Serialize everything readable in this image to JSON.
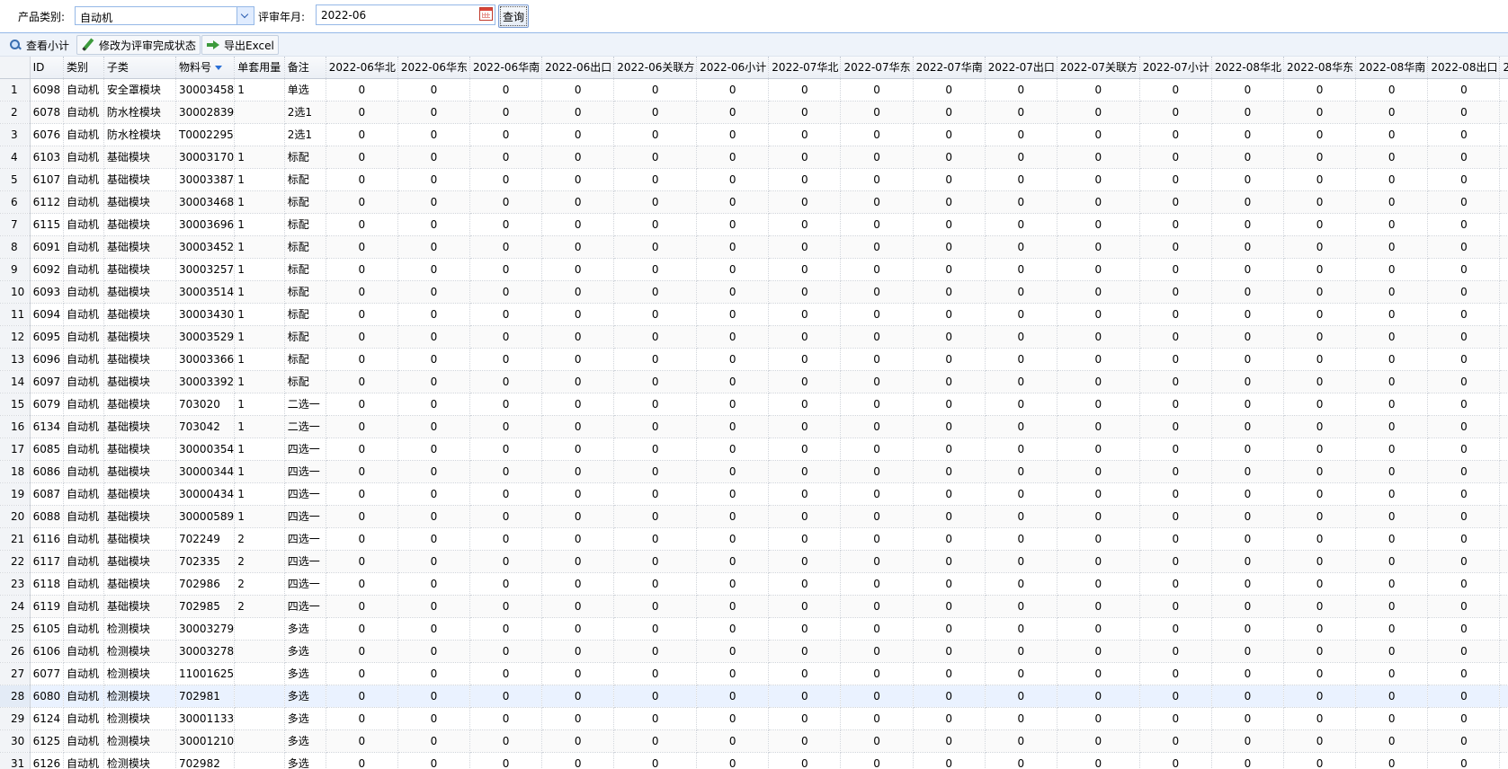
{
  "filter": {
    "category_label": "产品类别:",
    "category_value": "自动机",
    "month_label": "评审年月:",
    "month_value": "2022-06",
    "query_label": "查询"
  },
  "toolbar": {
    "view_subtotal": "查看小计",
    "mark_done": "修改为评审完成状态",
    "export_excel": "导出Excel"
  },
  "grid": {
    "columns": [
      "ID",
      "类别",
      "子类",
      "物料号",
      "单套用量",
      "备注",
      "2022-06华北",
      "2022-06华东",
      "2022-06华南",
      "2022-06出口",
      "2022-06关联方",
      "2022-06小计",
      "2022-07华北",
      "2022-07华东",
      "2022-07华南",
      "2022-07出口",
      "2022-07关联方",
      "2022-07小计",
      "2022-08华北",
      "2022-08华东",
      "2022-08华南",
      "2022-08出口",
      "2"
    ],
    "sorted_column": "物料号",
    "selected_row": 28,
    "rows": [
      [
        "1",
        "6098",
        "自动机",
        "安全罩模块",
        "30003458",
        "1",
        "单选"
      ],
      [
        "2",
        "6078",
        "自动机",
        "防水栓模块",
        "30002839",
        "",
        "2选1"
      ],
      [
        "3",
        "6076",
        "自动机",
        "防水栓模块",
        "T0002295",
        "",
        "2选1"
      ],
      [
        "4",
        "6103",
        "自动机",
        "基础模块",
        "30003170",
        "1",
        "标配"
      ],
      [
        "5",
        "6107",
        "自动机",
        "基础模块",
        "30003387",
        "1",
        "标配"
      ],
      [
        "6",
        "6112",
        "自动机",
        "基础模块",
        "30003468",
        "1",
        "标配"
      ],
      [
        "7",
        "6115",
        "自动机",
        "基础模块",
        "30003696",
        "1",
        "标配"
      ],
      [
        "8",
        "6091",
        "自动机",
        "基础模块",
        "30003452",
        "1",
        "标配"
      ],
      [
        "9",
        "6092",
        "自动机",
        "基础模块",
        "30003257",
        "1",
        "标配"
      ],
      [
        "10",
        "6093",
        "自动机",
        "基础模块",
        "30003514",
        "1",
        "标配"
      ],
      [
        "11",
        "6094",
        "自动机",
        "基础模块",
        "30003430",
        "1",
        "标配"
      ],
      [
        "12",
        "6095",
        "自动机",
        "基础模块",
        "30003529",
        "1",
        "标配"
      ],
      [
        "13",
        "6096",
        "自动机",
        "基础模块",
        "30003366",
        "1",
        "标配"
      ],
      [
        "14",
        "6097",
        "自动机",
        "基础模块",
        "30003392",
        "1",
        "标配"
      ],
      [
        "15",
        "6079",
        "自动机",
        "基础模块",
        "703020",
        "1",
        "二选一"
      ],
      [
        "16",
        "6134",
        "自动机",
        "基础模块",
        "703042",
        "1",
        "二选一"
      ],
      [
        "17",
        "6085",
        "自动机",
        "基础模块",
        "30000354",
        "1",
        "四选一"
      ],
      [
        "18",
        "6086",
        "自动机",
        "基础模块",
        "30000344",
        "1",
        "四选一"
      ],
      [
        "19",
        "6087",
        "自动机",
        "基础模块",
        "30000434",
        "1",
        "四选一"
      ],
      [
        "20",
        "6088",
        "自动机",
        "基础模块",
        "30000589",
        "1",
        "四选一"
      ],
      [
        "21",
        "6116",
        "自动机",
        "基础模块",
        "702249",
        "2",
        "四选一"
      ],
      [
        "22",
        "6117",
        "自动机",
        "基础模块",
        "702335",
        "2",
        "四选一"
      ],
      [
        "23",
        "6118",
        "自动机",
        "基础模块",
        "702986",
        "2",
        "四选一"
      ],
      [
        "24",
        "6119",
        "自动机",
        "基础模块",
        "702985",
        "2",
        "四选一"
      ],
      [
        "25",
        "6105",
        "自动机",
        "检测模块",
        "30003279",
        "",
        "多选"
      ],
      [
        "26",
        "6106",
        "自动机",
        "检测模块",
        "30003278",
        "",
        "多选"
      ],
      [
        "27",
        "6077",
        "自动机",
        "检测模块",
        "11001625",
        "",
        "多选"
      ],
      [
        "28",
        "6080",
        "自动机",
        "检测模块",
        "702981",
        "",
        "多选"
      ],
      [
        "29",
        "6124",
        "自动机",
        "检测模块",
        "30001133",
        "",
        "多选"
      ],
      [
        "30",
        "6125",
        "自动机",
        "检测模块",
        "30001210",
        "",
        "多选"
      ],
      [
        "31",
        "6126",
        "自动机",
        "检测模块",
        "702982",
        "",
        "多选"
      ]
    ],
    "quantity_value": "0"
  }
}
